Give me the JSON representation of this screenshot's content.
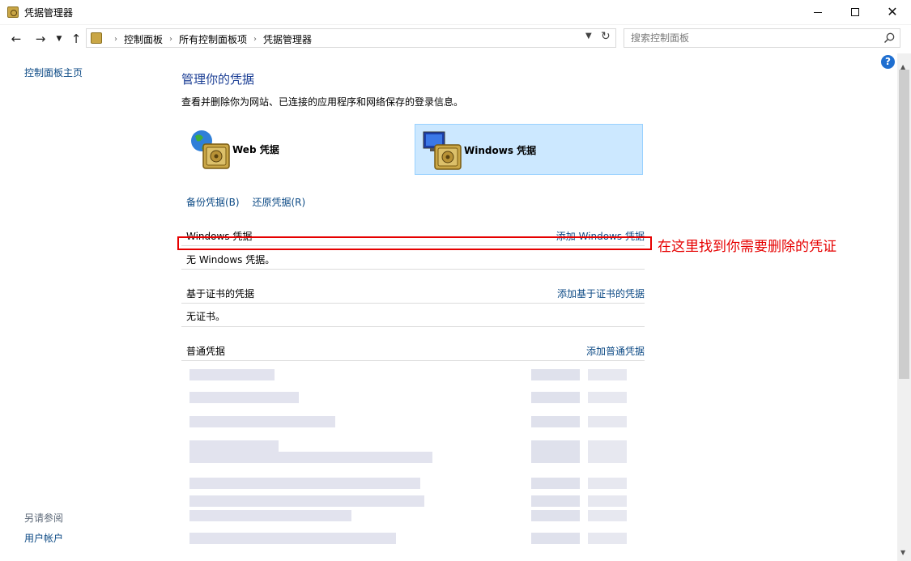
{
  "window": {
    "title": "凭据管理器",
    "minimize": "",
    "maximize": "",
    "close": "✕"
  },
  "toolbar": {
    "back": "←",
    "forward": "→",
    "recent": "⌄",
    "up": "↑",
    "breadcrumbs": [
      "控制面板",
      "所有控制面板项",
      "凭据管理器"
    ],
    "breadcrumb_sep": "›",
    "dropdown": "⌄",
    "refresh": "↻",
    "search_placeholder": "搜索控制面板"
  },
  "sidebar": {
    "home": "控制面板主页",
    "see_also": "另请参阅",
    "user_accounts": "用户帐户"
  },
  "main": {
    "title": "管理你的凭据",
    "description": "查看并删除你为网站、已连接的应用程序和网络保存的登录信息。",
    "cred_types": [
      {
        "label": "Web 凭据",
        "selected": false,
        "icon": "globe-vault-icon"
      },
      {
        "label": "Windows 凭据",
        "selected": true,
        "icon": "computer-vault-icon"
      }
    ],
    "backup_link": "备份凭据(B)",
    "restore_link": "还原凭据(R)",
    "sections": [
      {
        "heading": "Windows 凭据",
        "add_link": "添加 Windows 凭据",
        "empty_text": "无 Windows 凭据。"
      },
      {
        "heading": "基于证书的凭据",
        "add_link": "添加基于证书的凭据",
        "empty_text": "无证书。"
      },
      {
        "heading": "普通凭据",
        "add_link": "添加普通凭据"
      }
    ]
  },
  "annotation": {
    "text": "在这里找到你需要删除的凭证",
    "color": "#e60000"
  },
  "help": "?",
  "colors": {
    "link": "#0c4a85",
    "title": "#1c3f95",
    "selected_bg": "#cce8ff",
    "selected_border": "#99d1ff"
  }
}
